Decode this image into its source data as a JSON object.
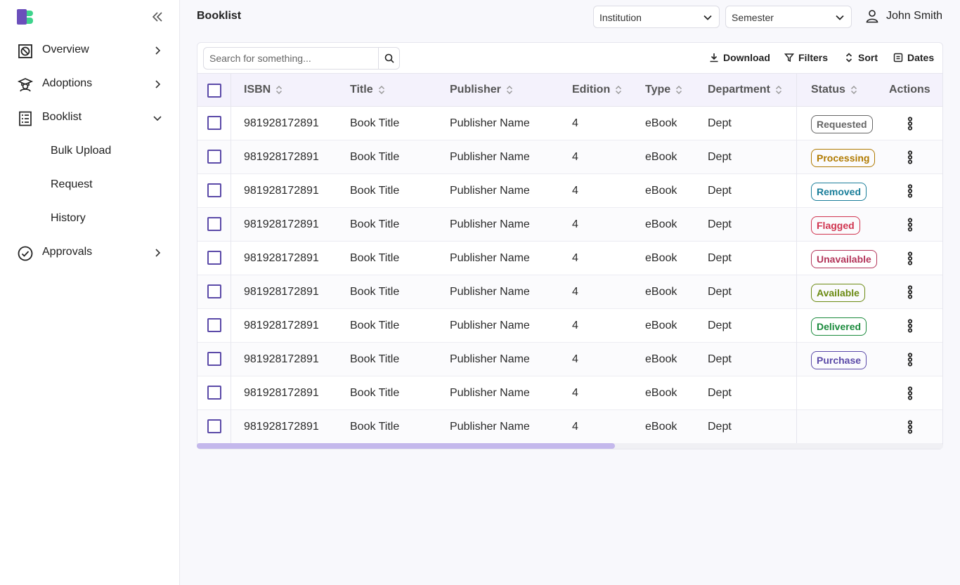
{
  "sidebar": {
    "items": [
      {
        "label": "Overview",
        "icon": "overview-icon"
      },
      {
        "label": "Adoptions",
        "icon": "adoptions-icon"
      },
      {
        "label": "Booklist",
        "icon": "booklist-icon",
        "expanded": true
      },
      {
        "label": "Approvals",
        "icon": "approvals-icon"
      }
    ],
    "subitems": [
      "Bulk Upload",
      "Request",
      "History"
    ]
  },
  "header": {
    "title": "Booklist",
    "institution": "Institution",
    "semester": "Semester",
    "user": "John Smith"
  },
  "toolbar": {
    "search_placeholder": "Search for something...",
    "download": "Download",
    "filters": "Filters",
    "sort": "Sort",
    "dates": "Dates"
  },
  "table": {
    "columns": [
      "ISBN",
      "Title",
      "Publisher",
      "Edition",
      "Type",
      "Department",
      "Status",
      "Actions"
    ],
    "rows": [
      {
        "isbn": "981928172891",
        "title": "Book Title",
        "publisher": "Publisher Name",
        "edition": "4",
        "type": "eBook",
        "dept": "Dept",
        "status": "Requested"
      },
      {
        "isbn": "981928172891",
        "title": "Book Title",
        "publisher": "Publisher Name",
        "edition": "4",
        "type": "eBook",
        "dept": "Dept",
        "status": "Processing"
      },
      {
        "isbn": "981928172891",
        "title": "Book Title",
        "publisher": "Publisher Name",
        "edition": "4",
        "type": "eBook",
        "dept": "Dept",
        "status": "Removed"
      },
      {
        "isbn": "981928172891",
        "title": "Book Title",
        "publisher": "Publisher Name",
        "edition": "4",
        "type": "eBook",
        "dept": "Dept",
        "status": "Flagged"
      },
      {
        "isbn": "981928172891",
        "title": "Book Title",
        "publisher": "Publisher Name",
        "edition": "4",
        "type": "eBook",
        "dept": "Dept",
        "status": "Unavailable"
      },
      {
        "isbn": "981928172891",
        "title": "Book Title",
        "publisher": "Publisher Name",
        "edition": "4",
        "type": "eBook",
        "dept": "Dept",
        "status": "Available"
      },
      {
        "isbn": "981928172891",
        "title": "Book Title",
        "publisher": "Publisher Name",
        "edition": "4",
        "type": "eBook",
        "dept": "Dept",
        "status": "Delivered"
      },
      {
        "isbn": "981928172891",
        "title": "Book Title",
        "publisher": "Publisher Name",
        "edition": "4",
        "type": "eBook",
        "dept": "Dept",
        "status": "Purchase"
      },
      {
        "isbn": "981928172891",
        "title": "Book Title",
        "publisher": "Publisher Name",
        "edition": "4",
        "type": "eBook",
        "dept": "Dept",
        "status": ""
      },
      {
        "isbn": "981928172891",
        "title": "Book Title",
        "publisher": "Publisher Name",
        "edition": "4",
        "type": "eBook",
        "dept": "Dept",
        "status": ""
      }
    ]
  },
  "status_colors": {
    "Requested": "#666666",
    "Processing": "#b07a00",
    "Removed": "#1a7e9a",
    "Flagged": "#d0344f",
    "Unavailable": "#b3355a",
    "Available": "#6b8a12",
    "Delivered": "#1a8a3c",
    "Purchase": "#5b4aa8"
  },
  "colors": {
    "accent": "#5b4aa8",
    "scrollbar": "#c4b8ec"
  },
  "horizontal_scroll_fraction": 0.56
}
